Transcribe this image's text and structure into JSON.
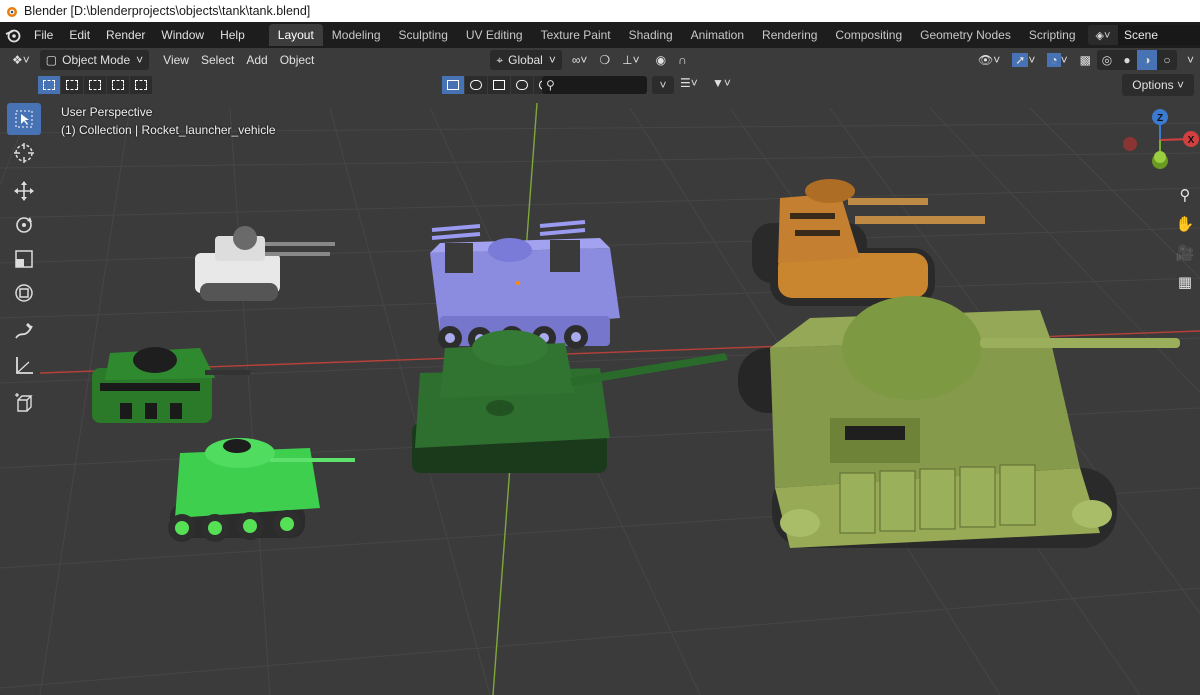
{
  "titlebar": {
    "title": "Blender [D:\\blenderprojects\\objects\\tank\\tank.blend]"
  },
  "menu": {
    "items": [
      "File",
      "Edit",
      "Render",
      "Window",
      "Help"
    ]
  },
  "workspaces": {
    "tabs": [
      "Layout",
      "Modeling",
      "Sculpting",
      "UV Editing",
      "Texture Paint",
      "Shading",
      "Animation",
      "Rendering",
      "Compositing",
      "Geometry Nodes",
      "Scripting"
    ],
    "active": "Layout",
    "add_label": "+"
  },
  "scene": {
    "name": "Scene"
  },
  "viewport_header": {
    "mode": "Object Mode",
    "menus": [
      "View",
      "Select",
      "Add",
      "Object"
    ],
    "orientation": "Global",
    "options_label": "Options"
  },
  "viewport_info": {
    "perspective": "User Perspective",
    "collection": "(1) Collection | Rocket_launcher_vehicle"
  },
  "gizmo": {
    "z": "Z",
    "x": "X"
  },
  "icons": {
    "toolbar": [
      "select-box-icon",
      "cursor-icon",
      "move-icon",
      "rotate-icon",
      "scale-icon",
      "transform-icon",
      "annotate-icon",
      "measure-icon",
      "add-cube-icon"
    ],
    "nav": [
      "zoom-icon",
      "hand-pan-icon",
      "camera-icon",
      "grid-perspective-icon"
    ]
  },
  "colors": {
    "viewport_bg": "#3b3b3b",
    "accent": "#4772b3",
    "axis_x": "#c0392b",
    "axis_y": "#8fbf3f"
  }
}
